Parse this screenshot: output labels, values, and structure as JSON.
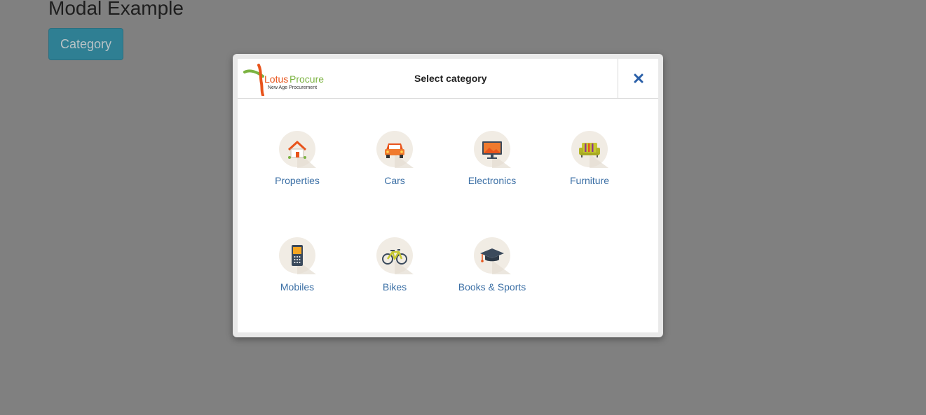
{
  "page": {
    "title": "Modal Example",
    "category_button": "Category"
  },
  "modal": {
    "logo": {
      "brand": "LotusProcure",
      "brand_part1": "Lotus",
      "brand_part2": "Procure",
      "tagline": "New Age Procurement"
    },
    "title": "Select category",
    "close_icon": "close-icon",
    "categories": [
      {
        "label": "Properties",
        "icon": "house-icon"
      },
      {
        "label": "Cars",
        "icon": "car-icon"
      },
      {
        "label": "Electronics",
        "icon": "monitor-icon"
      },
      {
        "label": "Furniture",
        "icon": "sofa-icon"
      },
      {
        "label": "Mobiles",
        "icon": "mobile-phone-icon"
      },
      {
        "label": "Bikes",
        "icon": "bicycle-icon"
      },
      {
        "label": "Books & Sports",
        "icon": "graduation-cap-icon"
      }
    ]
  },
  "colors": {
    "backdrop": "#808080",
    "button_bg": "#2f7f93",
    "link": "#3b6fa5",
    "close": "#2a5fa8"
  }
}
